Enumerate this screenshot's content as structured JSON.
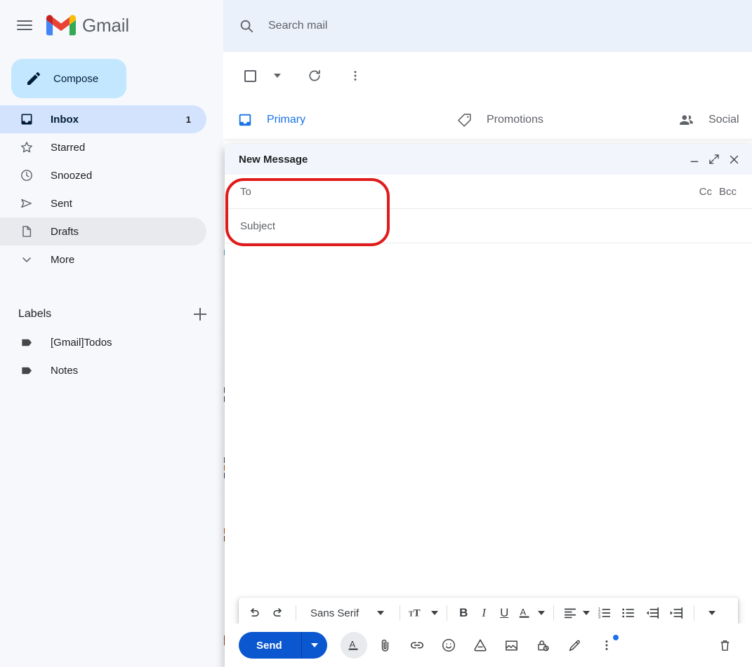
{
  "app": {
    "brand": "Gmail",
    "menu_icon": "hamburger-icon",
    "logo_icon": "gmail-logo-icon"
  },
  "sidebar": {
    "compose": {
      "label": "Compose",
      "icon": "pencil-icon"
    },
    "items": [
      {
        "label": "Inbox",
        "icon": "inbox-icon",
        "count": "1",
        "selected": true
      },
      {
        "label": "Starred",
        "icon": "star-icon",
        "count": "",
        "selected": false
      },
      {
        "label": "Snoozed",
        "icon": "clock-icon",
        "count": "",
        "selected": false
      },
      {
        "label": "Sent",
        "icon": "send-icon",
        "count": "",
        "selected": false
      },
      {
        "label": "Drafts",
        "icon": "draft-icon",
        "count": "",
        "selected": false
      },
      {
        "label": "More",
        "icon": "chevron-down-icon",
        "count": "",
        "selected": false
      }
    ],
    "labels_header": {
      "title": "Labels",
      "add_icon": "plus-icon"
    },
    "labels": [
      {
        "label": "[Gmail]Todos",
        "icon": "label-tag-icon"
      },
      {
        "label": "Notes",
        "icon": "label-tag-icon"
      }
    ]
  },
  "search": {
    "placeholder": "Search mail",
    "icon": "search-icon",
    "value": ""
  },
  "list_toolbar": {
    "select_all": {
      "icon": "checkbox-icon",
      "label": ""
    },
    "select_caret": {
      "icon": "chevron-down-icon"
    },
    "refresh": {
      "icon": "refresh-icon"
    },
    "more": {
      "icon": "more-vertical-icon"
    }
  },
  "tabs": [
    {
      "label": "Primary",
      "icon": "inbox-tab-icon",
      "active": true
    },
    {
      "label": "Promotions",
      "icon": "tag-icon",
      "active": false
    },
    {
      "label": "Social",
      "icon": "people-icon",
      "active": false
    }
  ],
  "compose": {
    "title": "New Message",
    "window_controls": [
      {
        "name": "minimize",
        "icon": "minimize-icon"
      },
      {
        "name": "fullscreen",
        "icon": "expand-icon"
      },
      {
        "name": "close",
        "icon": "close-icon"
      }
    ],
    "to": {
      "placeholder": "To",
      "value": ""
    },
    "cc": "Cc",
    "bcc": "Bcc",
    "subject": {
      "placeholder": "Subject",
      "value": ""
    },
    "body": {
      "value": ""
    },
    "format_toolbar": {
      "undo": "undo-icon",
      "redo": "redo-icon",
      "font_name": "Sans Serif",
      "font_caret": "chevron-down-icon",
      "font_size": "format-size-icon",
      "size_caret": "chevron-down-icon",
      "bold": "B",
      "italic": "I",
      "underline": "U",
      "text_color": "A",
      "color_caret": "chevron-down-icon",
      "align": "align-left-icon",
      "align_caret": "chevron-down-icon",
      "numbered_list": "numbered-list-icon",
      "bulleted_list": "bulleted-list-icon",
      "indent_less": "indent-decrease-icon",
      "indent_more": "indent-increase-icon",
      "overflow_caret": "chevron-down-icon"
    },
    "send": {
      "label": "Send",
      "caret": "chevron-down-icon"
    },
    "actions": [
      {
        "name": "formatting-options",
        "icon": "text-format-icon",
        "active": true
      },
      {
        "name": "attach-file",
        "icon": "paperclip-icon",
        "active": false
      },
      {
        "name": "insert-link",
        "icon": "link-icon",
        "active": false
      },
      {
        "name": "insert-emoji",
        "icon": "emoji-icon",
        "active": false
      },
      {
        "name": "insert-drive",
        "icon": "google-drive-icon",
        "active": false
      },
      {
        "name": "insert-photo",
        "icon": "image-icon",
        "active": false
      },
      {
        "name": "confidential-mode",
        "icon": "lock-clock-icon",
        "active": false
      },
      {
        "name": "insert-signature",
        "icon": "pen-icon",
        "active": false
      },
      {
        "name": "more-options",
        "icon": "more-vertical-icon",
        "active": false,
        "badge": true
      }
    ],
    "discard": {
      "name": "discard-draft",
      "icon": "trash-icon"
    }
  },
  "annotation": {
    "shape": "rounded-rectangle",
    "color": "#e01b1b",
    "targets": "to-and-subject-fields"
  },
  "colors": {
    "accent_blue": "#1a73e8",
    "send_blue": "#0b57d0",
    "sidebar_bg": "#f6f8fc",
    "search_bg": "#eaf1fb",
    "selected_nav": "#d3e3fd",
    "compose_btn": "#c2e7ff",
    "compose_header": "#f2f6fc",
    "annotation_red": "#e01b1b"
  }
}
